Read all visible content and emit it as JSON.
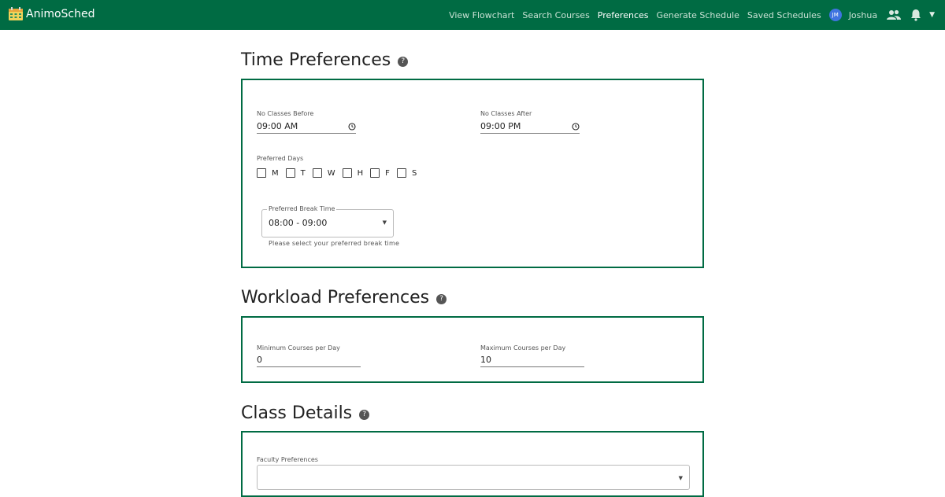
{
  "app": {
    "name": "AnimoSched"
  },
  "nav": {
    "links": [
      "View Flowchart",
      "Search Courses",
      "Preferences",
      "Generate Schedule",
      "Saved Schedules"
    ],
    "active": "Preferences",
    "user_initials": "JM",
    "user_name": "Joshua"
  },
  "colors": {
    "brand": "#006b43",
    "avatar": "#3f74e0"
  },
  "icons": [
    "calendar-logo-icon",
    "help-icon",
    "clock-icon",
    "people-icon",
    "bell-icon",
    "caret-down-icon"
  ],
  "time_preferences": {
    "title": "Time Preferences",
    "no_classes_before": {
      "label": "No Classes Before",
      "value": "09:00 AM"
    },
    "no_classes_after": {
      "label": "No Classes After",
      "value": "09:00 PM"
    },
    "preferred_days": {
      "label": "Preferred Days",
      "days": [
        {
          "label": "M",
          "checked": false
        },
        {
          "label": "T",
          "checked": false
        },
        {
          "label": "W",
          "checked": false
        },
        {
          "label": "H",
          "checked": false
        },
        {
          "label": "F",
          "checked": false
        },
        {
          "label": "S",
          "checked": false
        }
      ]
    },
    "break_time": {
      "label": "Preferred Break Time",
      "value": "08:00 - 09:00",
      "helper": "Please select your preferred break time"
    }
  },
  "workload_preferences": {
    "title": "Workload Preferences",
    "min_courses": {
      "label": "Minimum Courses per Day",
      "value": "0"
    },
    "max_courses": {
      "label": "Maximum Courses per Day",
      "value": "10"
    }
  },
  "class_details": {
    "title": "Class Details",
    "faculty_preferences": {
      "label": "Faculty Preferences",
      "value": ""
    }
  }
}
